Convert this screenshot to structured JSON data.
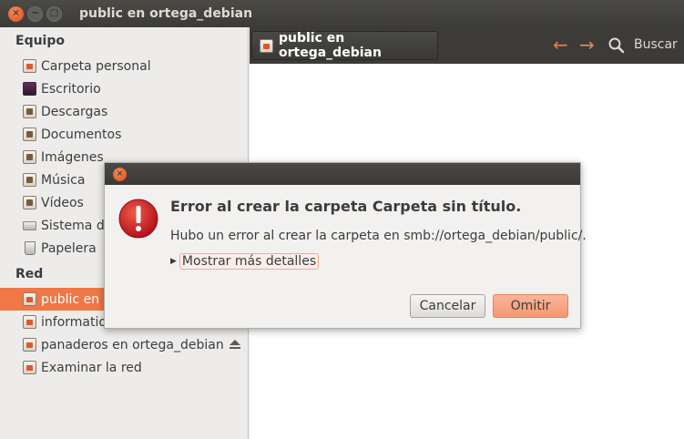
{
  "window": {
    "title": "public en ortega_debian",
    "close_glyph": "×",
    "minimize_glyph": "−",
    "maximize_glyph": "□"
  },
  "sidebar": {
    "sections": [
      {
        "title": "Equipo",
        "items": [
          {
            "label": "Carpeta personal",
            "icon": "home-folder-icon"
          },
          {
            "label": "Escritorio",
            "icon": "desktop-icon"
          },
          {
            "label": "Descargas",
            "icon": "downloads-folder-icon"
          },
          {
            "label": "Documentos",
            "icon": "documents-folder-icon"
          },
          {
            "label": "Imágenes",
            "icon": "pictures-folder-icon"
          },
          {
            "label": "Música",
            "icon": "music-folder-icon"
          },
          {
            "label": "Vídeos",
            "icon": "videos-folder-icon"
          },
          {
            "label": "Sistema de",
            "icon": "drive-icon"
          },
          {
            "label": "Papelera",
            "icon": "trash-icon"
          }
        ]
      },
      {
        "title": "Red",
        "items": [
          {
            "label": "public en o",
            "icon": "network-share-icon",
            "selected": true
          },
          {
            "label": "informatio",
            "icon": "network-share-icon"
          },
          {
            "label": "panaderos en ortega_debian",
            "icon": "network-share-icon",
            "eject": true
          },
          {
            "label": "Examinar la red",
            "icon": "network-share-icon"
          }
        ]
      }
    ]
  },
  "toolbar": {
    "path_label": "public en ortega_debian",
    "back_glyph": "←",
    "forward_glyph": "→",
    "search_label": "Buscar"
  },
  "dialog": {
    "close_glyph": "×",
    "heading": "Error al crear la carpeta Carpeta sin título.",
    "message": "Hubo un error al crear la carpeta en smb://ortega_debian/public/.",
    "expander_glyph": "▶",
    "expander_label": "Mostrar más detalles",
    "cancel_label": "Cancelar",
    "omit_label": "Omitir"
  },
  "colors": {
    "accent": "#f07746",
    "titlebar": "#3c3b37",
    "error_red": "#d0201f"
  }
}
